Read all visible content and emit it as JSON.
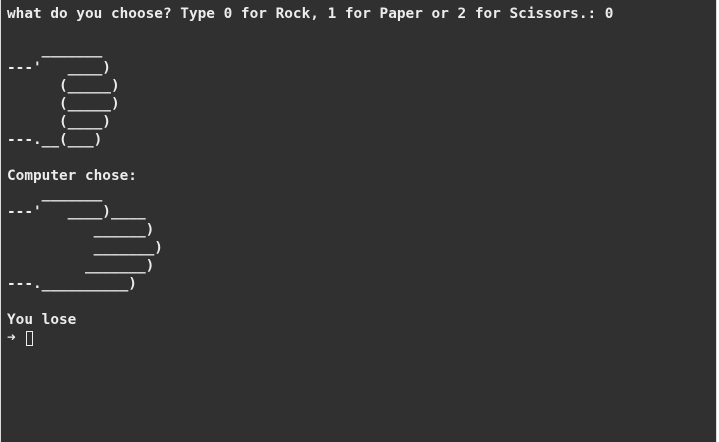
{
  "terminal": {
    "prompt_question": "what do you choose? Type 0 for Rock, 1 for Paper or 2 for Scissors.: 0",
    "user_ascii": "    _______\n---'   ____)\n      (_____)\n      (_____)\n      (____)\n---.__(___)",
    "computer_label": "Computer chose:",
    "computer_ascii": "    _______\n---'   ____)____\n          ______)\n          _______)\n         _______)\n---.__________)",
    "result": "You lose",
    "prompt_symbol": "➜"
  }
}
